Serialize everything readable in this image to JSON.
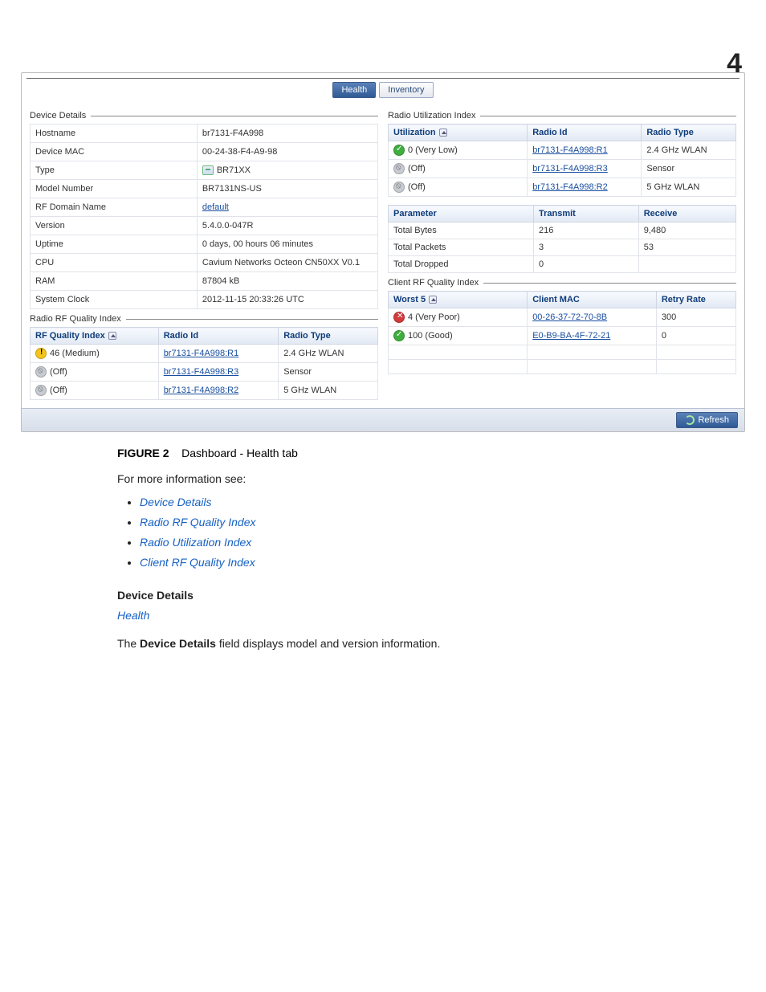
{
  "page_number": "4",
  "tabs": {
    "health": "Health",
    "inventory": "Inventory"
  },
  "device_details": {
    "title": "Device Details",
    "rows": [
      {
        "k": "Hostname",
        "v": "br7131-F4A998"
      },
      {
        "k": "Device MAC",
        "v": "00-24-38-F4-A9-98"
      },
      {
        "k": "Type",
        "v": "BR71XX",
        "icon": true
      },
      {
        "k": "Model Number",
        "v": "BR7131NS-US"
      },
      {
        "k": "RF Domain Name",
        "v": "default",
        "link": true
      },
      {
        "k": "Version",
        "v": "5.4.0.0-047R"
      },
      {
        "k": "Uptime",
        "v": "0 days, 00 hours 06 minutes"
      },
      {
        "k": "CPU",
        "v": "Cavium Networks Octeon CN50XX V0.1"
      },
      {
        "k": "RAM",
        "v": "87804 kB"
      },
      {
        "k": "System Clock",
        "v": "2012-11-15 20:33:26 UTC"
      }
    ]
  },
  "radio_rf": {
    "title": "Radio RF Quality Index",
    "headers": {
      "a": "RF Quality Index",
      "b": "Radio Id",
      "c": "Radio Type"
    },
    "rows": [
      {
        "icon": "yellow",
        "a": "46 (Medium)",
        "b": "br7131-F4A998:R1",
        "c": "2.4 GHz WLAN"
      },
      {
        "icon": "grey",
        "a": "(Off)",
        "b": "br7131-F4A998:R3",
        "c": "Sensor"
      },
      {
        "icon": "grey",
        "a": "(Off)",
        "b": "br7131-F4A998:R2",
        "c": "5 GHz WLAN"
      }
    ]
  },
  "radio_util": {
    "title": "Radio Utilization Index",
    "headers": {
      "a": "Utilization",
      "b": "Radio Id",
      "c": "Radio Type"
    },
    "rows": [
      {
        "icon": "green",
        "a": "0 (Very Low)",
        "b": "br7131-F4A998:R1",
        "c": "2.4 GHz WLAN"
      },
      {
        "icon": "grey",
        "a": "(Off)",
        "b": "br7131-F4A998:R3",
        "c": "Sensor"
      },
      {
        "icon": "grey",
        "a": "(Off)",
        "b": "br7131-F4A998:R2",
        "c": "5 GHz WLAN"
      }
    ],
    "param_headers": {
      "p": "Parameter",
      "t": "Transmit",
      "r": "Receive"
    },
    "params": [
      {
        "p": "Total Bytes",
        "t": "216",
        "r": "9,480"
      },
      {
        "p": "Total Packets",
        "t": "3",
        "r": "53"
      },
      {
        "p": "Total Dropped",
        "t": "0",
        "r": ""
      }
    ]
  },
  "client_rf": {
    "title": "Client RF Quality Index",
    "headers": {
      "a": "Worst 5",
      "b": "Client MAC",
      "c": "Retry Rate"
    },
    "rows": [
      {
        "icon": "red",
        "a": "4 (Very Poor)",
        "b": "00-26-37-72-70-8B",
        "c": "300"
      },
      {
        "icon": "green",
        "a": "100 (Good)",
        "b": "E0-B9-BA-4F-72-21",
        "c": "0"
      }
    ]
  },
  "refresh_label": "Refresh",
  "caption": {
    "prefix": "FIGURE 2",
    "text": "Dashboard - Health tab"
  },
  "body": {
    "intro": "For more information see:",
    "links": [
      "Device Details",
      "Radio RF Quality Index",
      "Radio Utilization Index",
      "Client RF Quality Index"
    ],
    "section_heading": "Device Details",
    "breadcrumb": "Health",
    "para_pre": "The ",
    "para_bold": "Device Details",
    "para_post": " field displays model and version information."
  }
}
